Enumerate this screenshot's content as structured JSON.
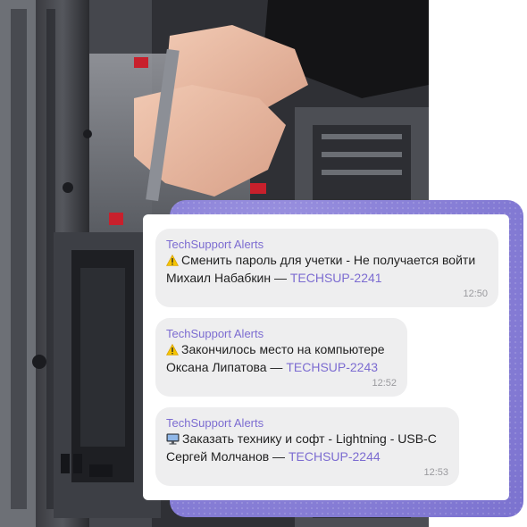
{
  "channel": {
    "name": "TechSupport Alerts"
  },
  "messages": [
    {
      "sender": "TechSupport Alerts",
      "icon": "warning-icon",
      "text": "Сменить пароль для учетки - Не получается войти",
      "author": "Михаил Набабкин —",
      "ticket": "TECHSUP-2241",
      "time": "12:50"
    },
    {
      "sender": "TechSupport Alerts",
      "icon": "warning-icon",
      "text": "Закончилось место на компьютере",
      "author": "Оксана Липатова  —",
      "ticket": "TECHSUP-2243",
      "time": "12:52"
    },
    {
      "sender": "TechSupport Alerts",
      "icon": "desktop-computer-icon",
      "text": "Заказать технику и софт - Lightning - USB-C",
      "author": "Сергей Молчанов  —",
      "ticket": "TECHSUP-2244",
      "time": "12:53"
    }
  ],
  "colors": {
    "accent": "#7c6cd1",
    "bubble": "#eeeeef",
    "purple_card": "#8d84d9"
  }
}
